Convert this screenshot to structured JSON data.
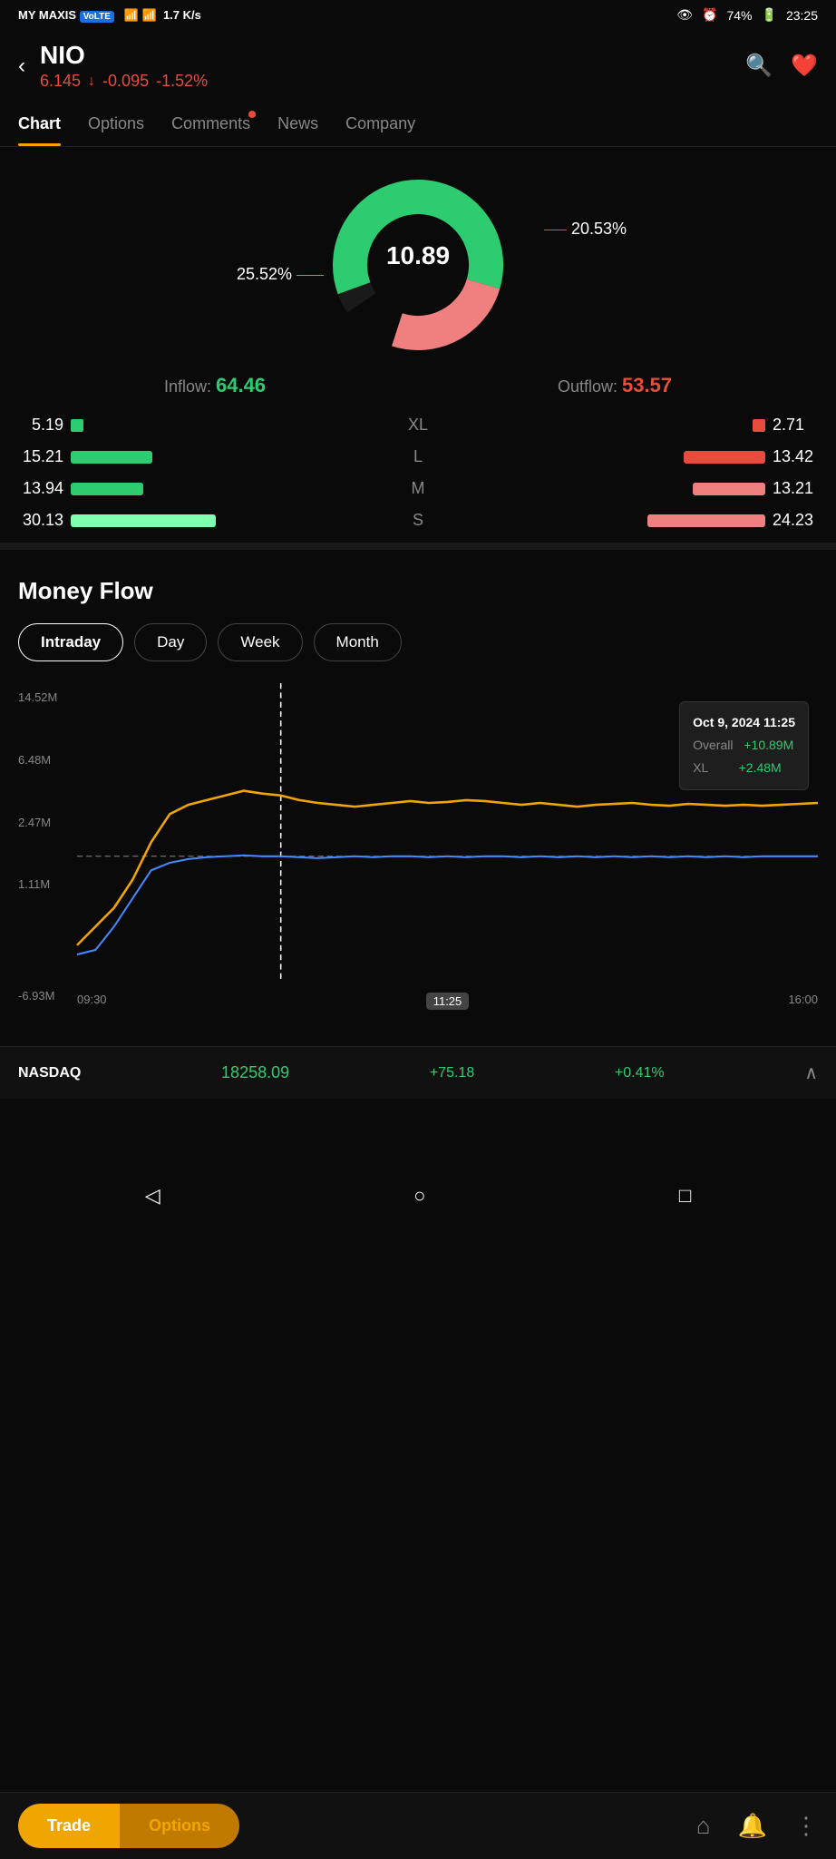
{
  "statusBar": {
    "carrier": "MY MAXIS",
    "volte": "VoLTE",
    "speed": "1.7 K/s",
    "battery": "74%",
    "time": "23:25"
  },
  "header": {
    "backLabel": "‹",
    "ticker": "NIO",
    "price": "6.145",
    "priceArrow": "↓",
    "change": "-0.095",
    "changePct": "-1.52%"
  },
  "navTabs": {
    "tabs": [
      {
        "label": "Chart",
        "active": true
      },
      {
        "label": "Options",
        "active": false
      },
      {
        "label": "Comments",
        "active": false,
        "hasDot": true
      },
      {
        "label": "News",
        "active": false
      },
      {
        "label": "Company",
        "active": false
      }
    ]
  },
  "donut": {
    "centerValue": "10.89",
    "leftLabel": "25.52%",
    "rightLabel": "20.53%"
  },
  "flowStats": {
    "inflowLabel": "Inflow:",
    "inflowValue": "64.46",
    "outflowLabel": "Outflow:",
    "outflowValue": "53.57",
    "rows": [
      {
        "leftVal": "5.19",
        "size": "XL",
        "rightVal": "2.71",
        "leftWidth": 30,
        "rightWidth": 30
      },
      {
        "leftVal": "15.21",
        "size": "L",
        "rightVal": "13.42",
        "leftWidth": 90,
        "rightWidth": 90
      },
      {
        "leftVal": "13.94",
        "size": "M",
        "rightVal": "13.21",
        "leftWidth": 80,
        "rightWidth": 80
      },
      {
        "leftVal": "30.13",
        "size": "S",
        "rightVal": "24.23",
        "leftWidth": 160,
        "rightWidth": 130
      }
    ]
  },
  "moneyFlow": {
    "title": "Money Flow",
    "tabs": [
      {
        "label": "Intraday",
        "active": true
      },
      {
        "label": "Day",
        "active": false
      },
      {
        "label": "Week",
        "active": false
      },
      {
        "label": "Month",
        "active": false
      }
    ]
  },
  "chart": {
    "yLabels": [
      "14.52M",
      "6.48M",
      "2.47M",
      "1.11M",
      "",
      "-6.93M"
    ],
    "xLabels": [
      "09:30",
      "11:25",
      "16:00"
    ],
    "activeX": "11:25",
    "dashedLineY": "2.47M"
  },
  "tooltip": {
    "date": "Oct 9, 2024 11:25",
    "overallLabel": "Overall",
    "overallValue": "+10.89M",
    "xlLabel": "XL",
    "xlValue": "+2.48M"
  },
  "ticker": {
    "name": "NASDAQ",
    "price": "18258.09",
    "change": "+75.18",
    "changePct": "+0.41%"
  },
  "bottomNav": {
    "tradeLabel": "Trade",
    "optionsLabel": "Options"
  }
}
